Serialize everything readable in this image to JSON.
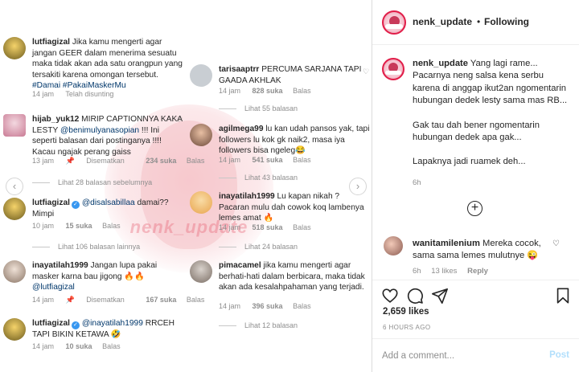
{
  "media": {
    "watermark": "nenk_update",
    "left_column": [
      {
        "user": "lutfiagizal",
        "text": "Jika kamu mengerti agar jangan GEER dalam menerima sesuatu maka tidak akan ada satu orangpun yang tersakiti karena omongan tersebut.",
        "tags": "#Damai #PakaiMaskerMu",
        "meta": [
          "14 jam",
          "Telah disunting"
        ]
      },
      {
        "user": "hijab_yuk12",
        "text": "MIRIP CAPTIONNYA KAKA LESTY",
        "mention": "@benimulyanasopian",
        "text2": "!!! Ini seperti balasan dari postinganya !!!! Kacau ngajak perang gaiss",
        "meta": [
          "13 jam",
          "Disematkan",
          "234 suka",
          "Balas"
        ]
      },
      {
        "thread": "Lihat 28 balasan sebelumnya"
      },
      {
        "user": "lutfiagizal",
        "mention": "@disalsabillaa",
        "text": "damai?? Mimpi",
        "meta": [
          "10 jam",
          "15 suka",
          "Balas"
        ]
      },
      {
        "thread": "Lihat 106 balasan lainnya"
      },
      {
        "user": "inayatilah1999",
        "text": "Jangan lupa pakai masker karna bau jigong 🔥🔥",
        "mention": "@lutfiagizal",
        "meta": [
          "14 jam",
          "Disematkan",
          "167 suka",
          "Balas"
        ]
      },
      {
        "user": "lutfiagizal",
        "mention": "@inayatilah1999",
        "text": "RRCEH TAPI BIKIN KETAWA 🤣",
        "meta": [
          "14 jam",
          "10 suka",
          "Balas"
        ]
      }
    ],
    "right_column": [
      {
        "user": "tarisaaptrr",
        "text": "PERCUMA SARJANA TAPI GAADA AKHLAK",
        "meta": [
          "14 jam",
          "828 suka",
          "Balas"
        ]
      },
      {
        "thread": "Lihat 55 balasan"
      },
      {
        "user": "agilmega99",
        "text": "lu kan udah pansos yak, tapi followers lu kok gk naik2, masa iya followers bisa ngeleg😂",
        "meta": [
          "14 jam",
          "541 suka",
          "Balas"
        ]
      },
      {
        "thread": "Lihat 43 balasan"
      },
      {
        "user": "inayatilah1999",
        "text": "Lu kapan nikah ? Pacaran mulu dah cowok koq lambenya lemes amat 🔥",
        "meta": [
          "14 jam",
          "518 suka",
          "Balas"
        ]
      },
      {
        "thread": "Lihat 24 balasan"
      },
      {
        "user": "pimacamel",
        "text": "jika kamu mengerti agar berhati-hati dalam berbicara, maka tidak akan ada kesalahpahaman yang terjadi.",
        "meta": [
          "14 jam",
          "396 suka",
          "Balas"
        ]
      },
      {
        "thread": "Lihat 12 balasan"
      }
    ]
  },
  "header": {
    "username": "nenk_update",
    "separator": "•",
    "follow_status": "Following"
  },
  "caption": {
    "username": "nenk_update",
    "line1": "Yang lagi rame... Pacarnya neng salsa kena serbu karena di anggap ikut2an ngomentarin hubungan dedek lesty sama mas RB...",
    "line2": "Gak tau dah bener ngomentarin hubungan dedek apa gak...",
    "line3": "Lapaknya jadi ruamek deh...",
    "time": "6h"
  },
  "reply": {
    "username": "wanitamilenium",
    "text": "Mereka cocok, sama sama lemes mulutnye 😜",
    "time": "6h",
    "likes": "13 likes",
    "reply_label": "Reply"
  },
  "actions": {
    "likes": "2,659 likes",
    "time_ago": "6 HOURS AGO"
  },
  "composer": {
    "placeholder": "Add a comment...",
    "post_label": "Post"
  },
  "colors": {
    "link": "#00376b",
    "muted": "#8e8e8e",
    "accent": "#3897f0",
    "post_disabled": "#b2dffc"
  }
}
